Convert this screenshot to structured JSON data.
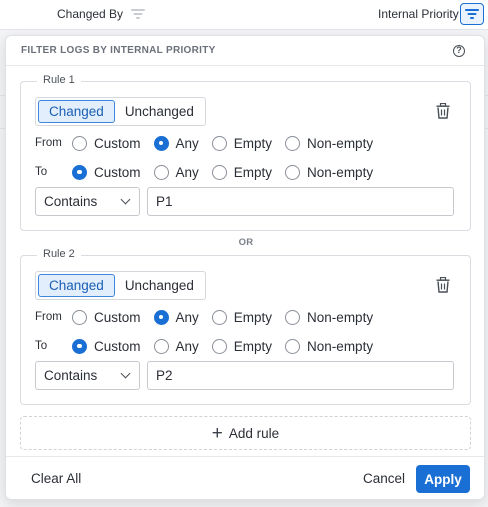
{
  "table_header": {
    "changed_by_label": "Changed By",
    "internal_priority_label": "Internal Priority",
    "changed_by_filter_icon": "filter-icon",
    "internal_priority_filter_icon": "filter-icon"
  },
  "popover": {
    "title": "FILTER LOGS BY INTERNAL PRIORITY",
    "help_icon": "question-circle-icon",
    "help_glyph": "?",
    "or_label": "OR",
    "add_rule_label": "Add rule",
    "add_rule_icon": "plus-icon",
    "add_rule_glyph": "+",
    "clear_all_label": "Clear All",
    "cancel_label": "Cancel",
    "apply_label": "Apply",
    "accent_color": "#1a6fd4"
  },
  "rules": [
    {
      "legend": "Rule 1",
      "change_options": [
        "Changed",
        "Unchanged"
      ],
      "change_selected": "Changed",
      "from_label": "From",
      "to_label": "To",
      "value_options": [
        "Custom",
        "Any",
        "Empty",
        "Non-empty"
      ],
      "from_selected": "Any",
      "to_selected": "Custom",
      "operator": "Contains",
      "value": "P1",
      "delete_icon": "trash-icon"
    },
    {
      "legend": "Rule 2",
      "change_options": [
        "Changed",
        "Unchanged"
      ],
      "change_selected": "Changed",
      "from_label": "From",
      "to_label": "To",
      "value_options": [
        "Custom",
        "Any",
        "Empty",
        "Non-empty"
      ],
      "from_selected": "Any",
      "to_selected": "Custom",
      "operator": "Contains",
      "value": "P2",
      "delete_icon": "trash-icon"
    }
  ]
}
